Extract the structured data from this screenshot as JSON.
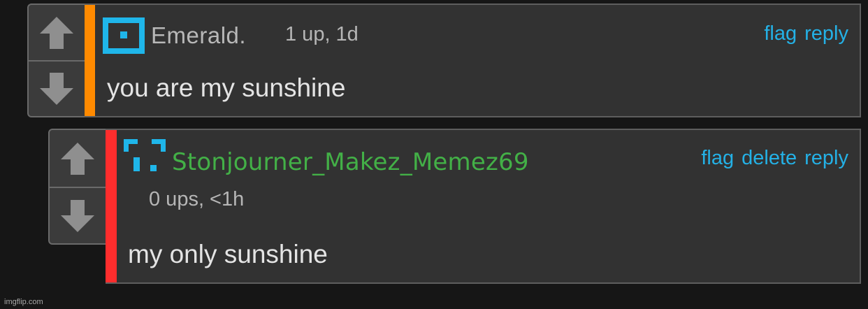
{
  "comments": [
    {
      "username": "Emerald.",
      "meta": "1 up, 1d",
      "actions": [
        "flag",
        "reply"
      ],
      "text": "you are my sunshine",
      "bar_color": "#ff8a00",
      "username_color": "#b8b8b8",
      "avatar_icon": "pixel-target-icon"
    },
    {
      "username": "Stonjourner_Makez_Memez69",
      "meta": "0 ups, <1h",
      "actions": [
        "flag",
        "delete",
        "reply"
      ],
      "text": "my only sunshine",
      "bar_color": "#ff2d2d",
      "username_color": "#43b047",
      "avatar_icon": "pixel-corners-icon"
    }
  ],
  "vote": {
    "up_icon": "up-arrow-icon",
    "down_icon": "down-arrow-icon"
  },
  "watermark": "imgflip.com"
}
